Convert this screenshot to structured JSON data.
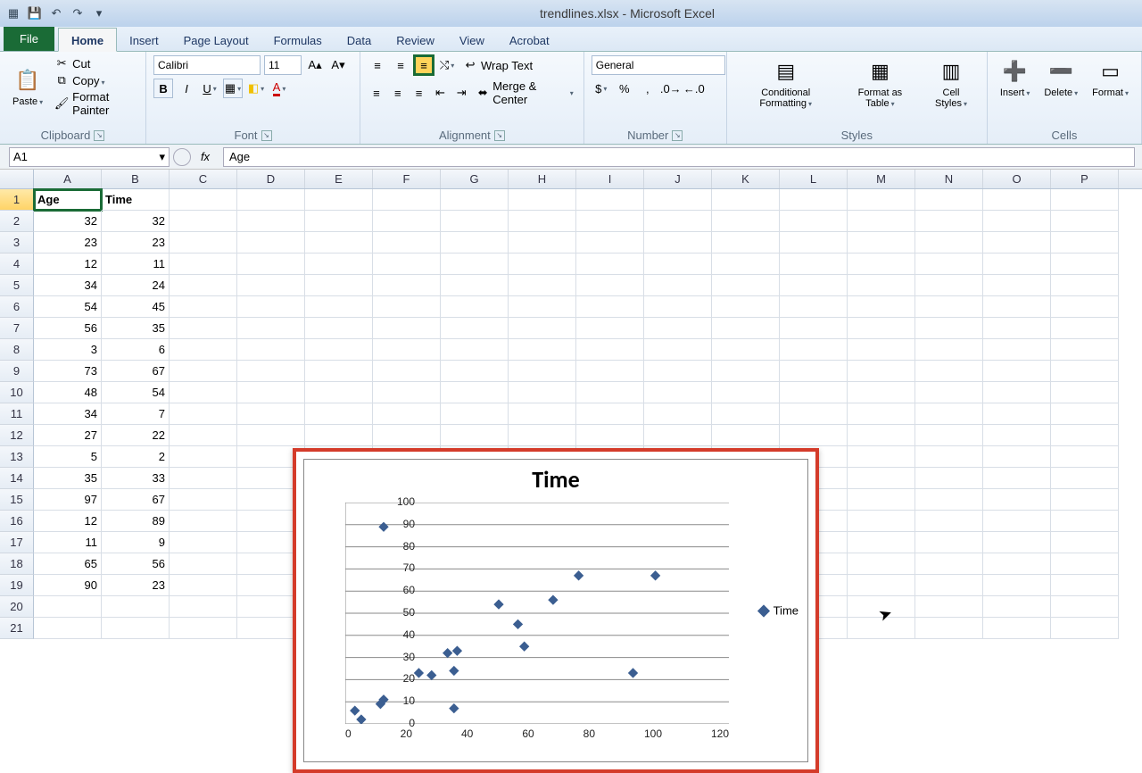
{
  "app": {
    "title": "trendlines.xlsx - Microsoft Excel"
  },
  "tabs": {
    "file": "File",
    "home": "Home",
    "insert": "Insert",
    "pagelayout": "Page Layout",
    "formulas": "Formulas",
    "data": "Data",
    "review": "Review",
    "view": "View",
    "acrobat": "Acrobat"
  },
  "ribbon": {
    "clipboard": {
      "label": "Clipboard",
      "paste": "Paste",
      "cut": "Cut",
      "copy": "Copy",
      "fp": "Format Painter"
    },
    "font": {
      "label": "Font",
      "name": "Calibri",
      "size": "11"
    },
    "alignment": {
      "label": "Alignment",
      "wrap": "Wrap Text",
      "merge": "Merge & Center"
    },
    "number": {
      "label": "Number",
      "format": "General"
    },
    "styles": {
      "label": "Styles",
      "cf": "Conditional Formatting",
      "fat": "Format as Table",
      "cs": "Cell Styles"
    },
    "cells": {
      "label": "Cells",
      "insert": "Insert",
      "delete": "Delete",
      "format": "Format"
    }
  },
  "formula": {
    "name": "A1",
    "value": "Age"
  },
  "columns": [
    "A",
    "B",
    "C",
    "D",
    "E",
    "F",
    "G",
    "H",
    "I",
    "J",
    "K",
    "L",
    "M",
    "N",
    "O",
    "P"
  ],
  "sheet": {
    "headers": [
      "Age",
      "Time"
    ],
    "rows": [
      [
        32,
        32
      ],
      [
        23,
        23
      ],
      [
        12,
        11
      ],
      [
        34,
        24
      ],
      [
        54,
        45
      ],
      [
        56,
        35
      ],
      [
        3,
        6
      ],
      [
        73,
        67
      ],
      [
        48,
        54
      ],
      [
        34,
        7
      ],
      [
        27,
        22
      ],
      [
        5,
        2
      ],
      [
        35,
        33
      ],
      [
        97,
        67
      ],
      [
        12,
        89
      ],
      [
        11,
        9
      ],
      [
        65,
        56
      ],
      [
        90,
        23
      ]
    ]
  },
  "chart_data": {
    "type": "scatter",
    "title": "Time",
    "series": [
      {
        "name": "Time",
        "x": [
          32,
          23,
          12,
          34,
          54,
          56,
          3,
          73,
          48,
          34,
          27,
          5,
          35,
          97,
          12,
          11,
          65,
          90
        ],
        "y": [
          32,
          23,
          11,
          24,
          45,
          35,
          6,
          67,
          54,
          7,
          22,
          2,
          33,
          67,
          89,
          9,
          56,
          23
        ]
      }
    ],
    "xlim": [
      0,
      120
    ],
    "ylim": [
      0,
      100
    ],
    "xticks": [
      0,
      20,
      40,
      60,
      80,
      100,
      120
    ],
    "yticks": [
      0,
      10,
      20,
      30,
      40,
      50,
      60,
      70,
      80,
      90,
      100
    ],
    "legend": "Time"
  }
}
